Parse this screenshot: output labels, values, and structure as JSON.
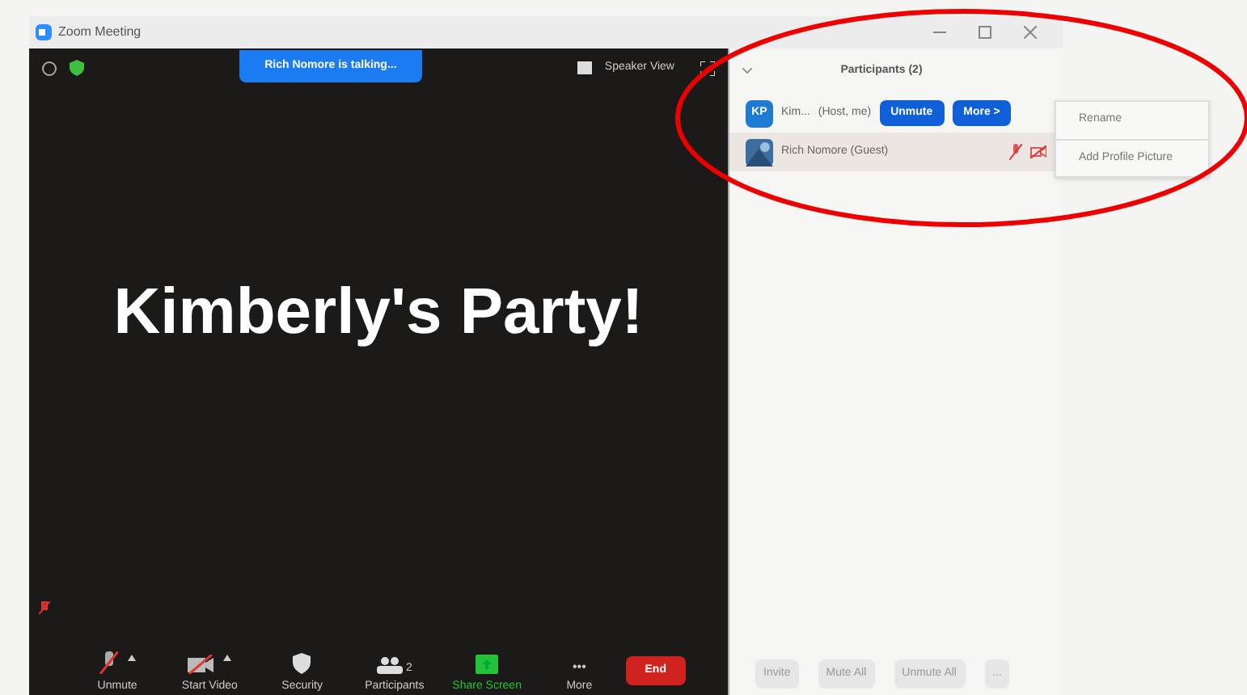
{
  "window": {
    "title": "Zoom Meeting"
  },
  "banner": "Rich Nomore is talking...",
  "view_button": "Speaker View",
  "meeting_name": "Kimberly's Party!",
  "toolbar": [
    {
      "kind": "mic",
      "label": "Unmute"
    },
    {
      "kind": "video",
      "label": "Start Video"
    },
    {
      "kind": "security",
      "label": "Security"
    },
    {
      "kind": "participants",
      "label": "Participants",
      "count": "2"
    },
    {
      "kind": "share",
      "label": "Share Screen"
    },
    {
      "kind": "more",
      "label": "More",
      "glyph": "•••"
    },
    {
      "kind": "end",
      "label": "End"
    }
  ],
  "participants_panel": {
    "title": "Participants (2)",
    "participants": [
      {
        "initials": "KP",
        "name": "Kim...",
        "role": "(Host, me)",
        "kind": "initials",
        "buttons": [
          "Unmute",
          "More >"
        ]
      },
      {
        "name": "Rich Nomore (Guest)",
        "muted": true,
        "video_off": true
      }
    ],
    "menu": [
      "Rename",
      "Add Profile Picture"
    ],
    "footer": [
      "Invite",
      "Mute All",
      "Unmute All",
      "..."
    ]
  }
}
